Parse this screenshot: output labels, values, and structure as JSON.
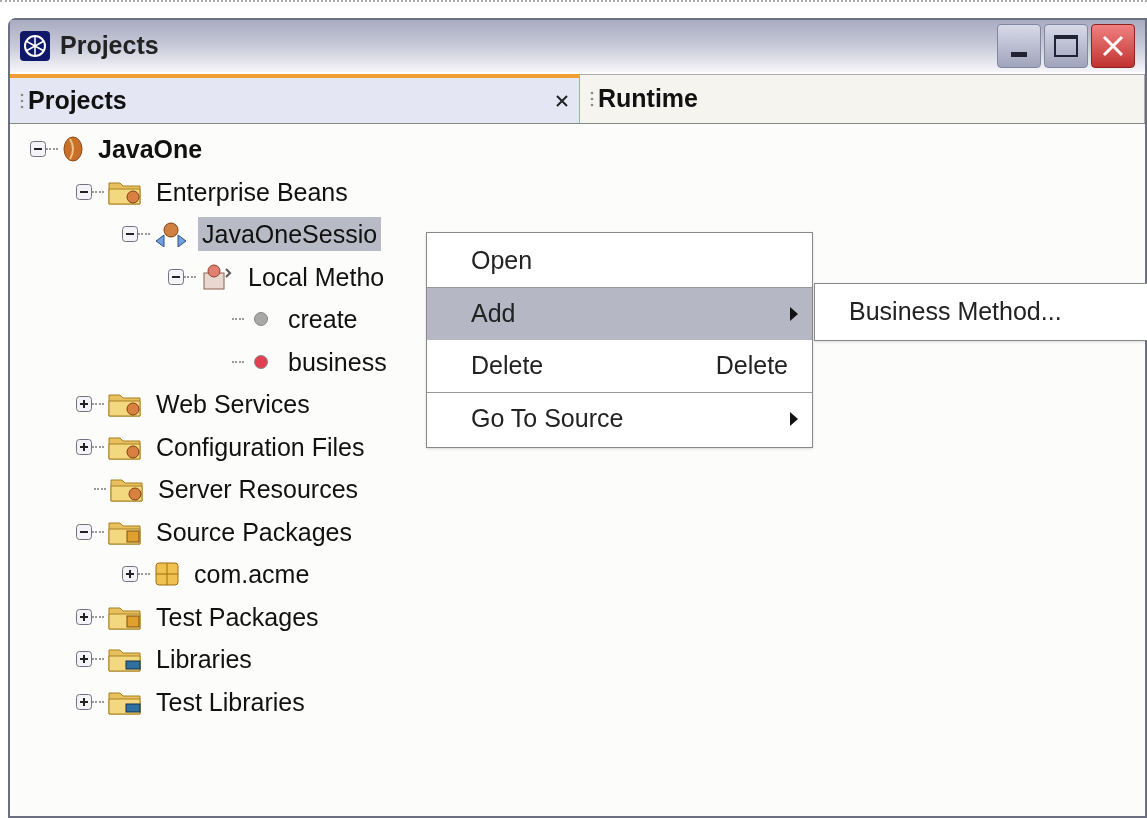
{
  "window": {
    "title": "Projects"
  },
  "tabs": [
    {
      "label": "Projects",
      "selected": true,
      "closable": true
    },
    {
      "label": "Runtime",
      "selected": false,
      "closable": false
    }
  ],
  "tree": [
    {
      "label": "JavaOne",
      "kind": "project",
      "expanded": true,
      "selected": false,
      "bold": true,
      "children": [
        {
          "label": "Enterprise Beans",
          "kind": "folder",
          "expanded": true,
          "selected": false,
          "children": [
            {
              "label": "JavaOneSessio",
              "kind": "bean",
              "expanded": true,
              "selected": true,
              "children": [
                {
                  "label": "Local Metho",
                  "kind": "interface",
                  "expanded": true,
                  "selected": false,
                  "children": [
                    {
                      "label": "create",
                      "kind": "method",
                      "color": "#a8a8a8",
                      "selected": false
                    },
                    {
                      "label": "business",
                      "kind": "method",
                      "color": "#e04050",
                      "selected": false
                    }
                  ]
                }
              ]
            }
          ]
        },
        {
          "label": "Web Services",
          "kind": "folder",
          "expanded": false,
          "selected": false
        },
        {
          "label": "Configuration Files",
          "kind": "folder",
          "expanded": false,
          "selected": false
        },
        {
          "label": "Server Resources",
          "kind": "folder",
          "selected": false
        },
        {
          "label": "Source Packages",
          "kind": "package-folder",
          "expanded": true,
          "selected": false,
          "children": [
            {
              "label": "com.acme",
              "kind": "package",
              "expanded": false,
              "selected": false
            }
          ]
        },
        {
          "label": "Test Packages",
          "kind": "package-folder",
          "expanded": false,
          "selected": false
        },
        {
          "label": "Libraries",
          "kind": "library-folder",
          "expanded": false,
          "selected": false
        },
        {
          "label": "Test Libraries",
          "kind": "library-folder",
          "expanded": false,
          "selected": false
        }
      ]
    }
  ],
  "context_menu": {
    "items": [
      {
        "label": "Open",
        "selected": false,
        "submenu": false,
        "separator_before": false
      },
      {
        "label": "Add",
        "selected": true,
        "submenu": true,
        "separator_before": true
      },
      {
        "label": "Delete",
        "shortcut": "Delete",
        "selected": false,
        "submenu": false,
        "separator_before": false
      },
      {
        "label": "Go To Source",
        "selected": false,
        "submenu": true,
        "separator_before": true
      }
    ]
  },
  "submenu": {
    "items": [
      {
        "label": "Business Method...",
        "selected": false
      }
    ]
  }
}
